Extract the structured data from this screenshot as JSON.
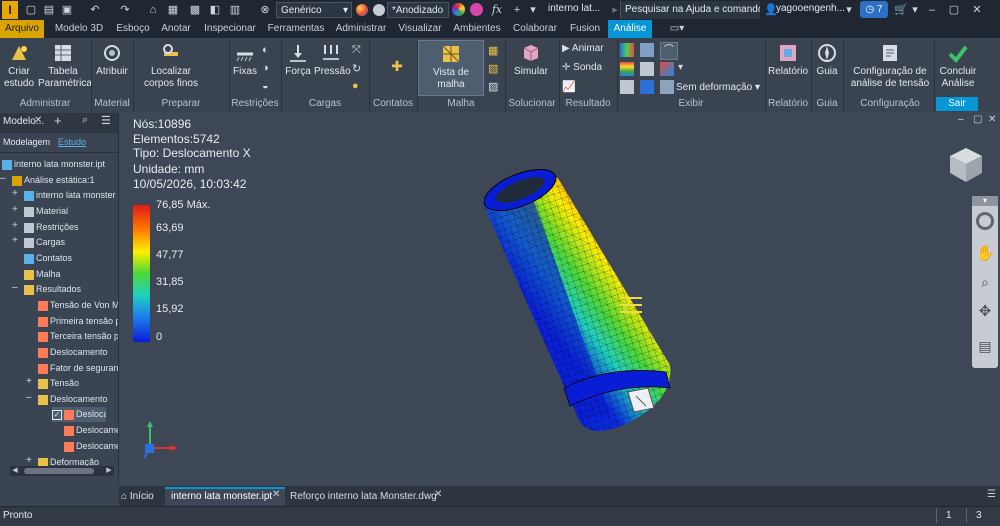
{
  "titlebar": {
    "app_logo": "I",
    "appearance_combo": "Genérico",
    "material_combo": "*Anodizado",
    "doc_title": "interno lat...",
    "search_placeholder": "Pesquisar na Ajuda e comandos...",
    "user": "yagooengenh...",
    "notif_count": "7"
  },
  "menu_tabs": [
    "Arquivo",
    "Modelo 3D",
    "Esboço",
    "Anotar",
    "Inspecionar",
    "Ferramentas",
    "Administrar",
    "Visualizar",
    "Ambientes",
    "Colaborar",
    "Fusion",
    "Análise"
  ],
  "ribbon": {
    "criar_estudo": "Criar estudo",
    "tabela_parametrica": "Tabela Paramétrica",
    "atribuir": "Atribuir",
    "localizar_corpos": "Localizar corpos finos",
    "fixas": "Fixas",
    "forca": "Força",
    "pressao": "Pressão",
    "vista_malha": "Vista de malha",
    "simular": "Simular",
    "animar": "Animar",
    "sonda": "Sonda",
    "sem_deformacao": "Sem deformação",
    "relatorio": "Relatório",
    "guia": "Guia",
    "configuracao": "Configuração de análise de tensão",
    "concluir": "Concluir Análise",
    "panels": {
      "administrar": "Administrar",
      "material": "Material",
      "preparar": "Preparar",
      "restricoes": "Restrições",
      "cargas": "Cargas",
      "contatos": "Contatos",
      "malha": "Malha",
      "solucionar": "Solucionar",
      "resultado": "Resultado",
      "exibir": "Exibir",
      "relatorio": "Relatório",
      "guia": "Guia",
      "configuracao": "Configuração",
      "sair": "Sair"
    }
  },
  "browser": {
    "header": "Modelo...",
    "tab_modelagem": "Modelagem",
    "tab_estudo": "Estudo",
    "items": [
      {
        "label": "interno lata monster.ipt"
      },
      {
        "label": "Análise estática:1"
      },
      {
        "label": "interno lata monster"
      },
      {
        "label": "Material"
      },
      {
        "label": "Restrições"
      },
      {
        "label": "Cargas"
      },
      {
        "label": "Contatos"
      },
      {
        "label": "Malha"
      },
      {
        "label": "Resultados"
      },
      {
        "label": "Tensão de Von M"
      },
      {
        "label": "Primeira tensão p"
      },
      {
        "label": "Terceira tensão p"
      },
      {
        "label": "Deslocamento"
      },
      {
        "label": "Fator de seguran"
      },
      {
        "label": "Tensão"
      },
      {
        "label": "Deslocamento"
      },
      {
        "label": "Deslocame"
      },
      {
        "label": "Deslocamento"
      },
      {
        "label": "Deslocamento"
      },
      {
        "label": "Deformação"
      }
    ]
  },
  "viewport": {
    "nodes": "Nós:10896",
    "elements": "Elementos:5742",
    "type": "Tipo: Deslocamento X",
    "unit": "Unidade: mm",
    "datetime": "10/05/2026, 10:03:42",
    "legend": [
      "76,85 Máx.",
      "63,69",
      "47,77",
      "31,85",
      "15,92",
      "0"
    ]
  },
  "doctabs": {
    "home": "Início",
    "tab1": "interno lata monster.ipt",
    "tab2": "Reforço interno lata Monster.dwg"
  },
  "status": {
    "left": "Pronto",
    "n1": "1",
    "n2": "3"
  },
  "colors": {
    "accent": "#0696d7",
    "arquivo": "#d9a400"
  }
}
